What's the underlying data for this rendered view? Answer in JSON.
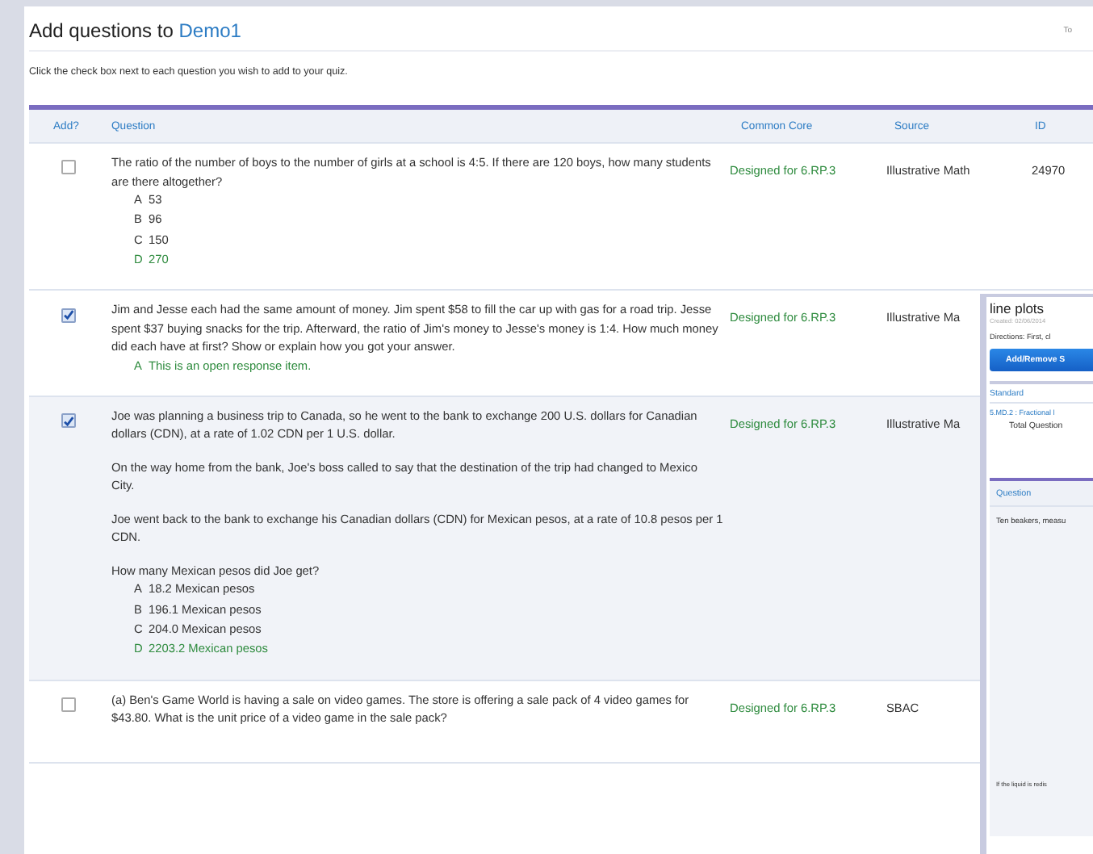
{
  "header": {
    "title": "Add questions to ",
    "quiz_name": "Demo1",
    "corner_text": "To",
    "instructions": "Click the check box next to each question you wish to add to your quiz."
  },
  "table": {
    "columns": [
      "Add?",
      "Question",
      "Common Core",
      "Source",
      "ID"
    ],
    "rows": [
      {
        "checked": false,
        "highlighted": false,
        "paragraphs": [
          "The ratio of the number of boys to the number of girls at a school is 4:5. If there are 120 boys, how many students are there altogether?"
        ],
        "choices": [
          {
            "letter": "A",
            "text": "53",
            "correct": false
          },
          {
            "letter": "B",
            "text": "96",
            "correct": false
          },
          {
            "letter": "C",
            "text": "150",
            "correct": false
          },
          {
            "letter": "D",
            "text": "270",
            "correct": true
          }
        ],
        "common_core": "Designed for 6.RP.3",
        "source": "Illustrative Math",
        "id": "24970"
      },
      {
        "checked": true,
        "highlighted": false,
        "paragraphs": [
          "Jim and Jesse each had the same amount of money. Jim spent $58 to fill the car up with gas for a road trip. Jesse spent $37 buying snacks for the trip. Afterward, the ratio of Jim's money to Jesse's money is 1:4. How much money did each have at first? Show or explain how you got your answer."
        ],
        "choices": [
          {
            "letter": "A",
            "text": "This is an open response item.",
            "correct": true
          }
        ],
        "common_core": "Designed for 6.RP.3",
        "source": "Illustrative Ma",
        "id": ""
      },
      {
        "checked": true,
        "highlighted": true,
        "paragraphs": [
          "Joe was planning a business trip to Canada, so he went to the bank to exchange 200 U.S. dollars for Canadian dollars (CDN), at a rate of 1.02 CDN per 1 U.S. dollar.",
          "On the way home from the bank, Joe's boss called to say that the destination of the trip had changed to Mexico City.",
          "Joe went back to the bank to exchange his Canadian dollars (CDN) for Mexican pesos, at a rate of 10.8 pesos per 1 CDN.",
          "How many Mexican pesos did Joe get?"
        ],
        "choices": [
          {
            "letter": "A",
            "text": "18.2 Mexican pesos",
            "correct": false
          },
          {
            "letter": "B",
            "text": "196.1 Mexican pesos",
            "correct": false
          },
          {
            "letter": "C",
            "text": "204.0 Mexican pesos",
            "correct": false
          },
          {
            "letter": "D",
            "text": "2203.2 Mexican pesos",
            "correct": true
          }
        ],
        "common_core": "Designed for 6.RP.3",
        "source": "Illustrative Ma",
        "id": ""
      },
      {
        "checked": false,
        "highlighted": false,
        "paragraphs": [
          "(a) Ben's Game World is having a sale on video games. The store is offering a sale pack of 4 video games for $43.80. What is the unit price of a video game in the sale pack?"
        ],
        "choices": [],
        "common_core": "Designed for 6.RP.3",
        "source": "SBAC",
        "id": ""
      }
    ]
  },
  "side_panel": {
    "title": "line plots",
    "created": "Created: 02/06/2014",
    "directions": "Directions: First, cl",
    "button": "Add/Remove S",
    "standard_heading": "Standard",
    "standard": "5.MD.2 : Fractional l",
    "total": "Total Question",
    "question_heading": "Question",
    "question": "Ten beakers, measu",
    "footer": "If the liquid is redis"
  }
}
